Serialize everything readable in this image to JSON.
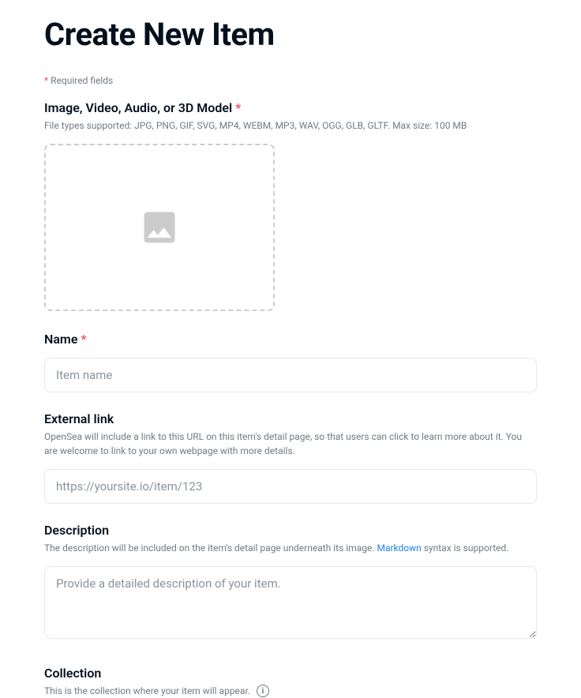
{
  "page_title": "Create New Item",
  "required_note": "Required fields",
  "media": {
    "label": "Image, Video, Audio, or 3D Model",
    "required": true,
    "helper": "File types supported: JPG, PNG, GIF, SVG, MP4, WEBM, MP3, WAV, OGG, GLB, GLTF. Max size: 100 MB"
  },
  "name": {
    "label": "Name",
    "required": true,
    "placeholder": "Item name"
  },
  "external_link": {
    "label": "External link",
    "helper": "OpenSea will include a link to this URL on this item's detail page, so that users can click to learn more about it. You are welcome to link to your own webpage with more details.",
    "placeholder": "https://yoursite.io/item/123"
  },
  "description": {
    "label": "Description",
    "helper_before": "The description will be included on the item's detail page underneath its image. ",
    "helper_link": "Markdown",
    "helper_after": " syntax is supported.",
    "placeholder": "Provide a detailed description of your item."
  },
  "collection": {
    "label": "Collection",
    "helper": "This is the collection where your item will appear."
  }
}
